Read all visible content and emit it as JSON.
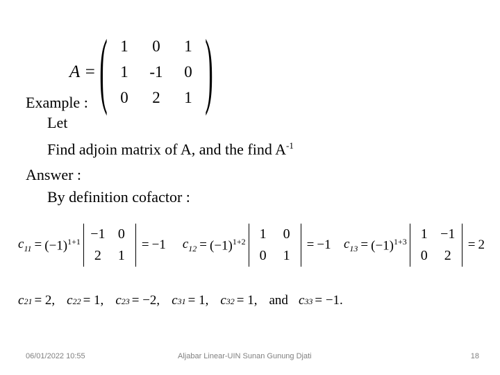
{
  "slide": {
    "background": "#ffffff",
    "text_color": "#000000",
    "footer_color": "#808080"
  },
  "matrix_a": {
    "label": "A =",
    "open_paren": "(",
    "close_paren": ")",
    "rows": [
      [
        "1",
        "0",
        "1"
      ],
      [
        "1",
        "-1",
        "0"
      ],
      [
        "0",
        "2",
        "1"
      ]
    ]
  },
  "body": {
    "example_label": "Example :",
    "let_label": "Let",
    "find_text": "Find  adjoin matrix  of A, and the find A",
    "find_sup": "-1",
    "answer_label": "Answer :",
    "by_definition": "By definition cofactor :"
  },
  "cofactors_detail": [
    {
      "name": "c",
      "sub": "11",
      "eq1": "=",
      "sign": "(−1)",
      "exponent": "1+1",
      "minor": [
        [
          "−1",
          "0"
        ],
        [
          "2",
          "1"
        ]
      ],
      "eq2": "=",
      "result": "−1"
    },
    {
      "name": "c",
      "sub": "12",
      "eq1": "=",
      "sign": "(−1)",
      "exponent": "1+2",
      "minor": [
        [
          "1",
          "0"
        ],
        [
          "0",
          "1"
        ]
      ],
      "eq2": "=",
      "result": "−1"
    },
    {
      "name": "c",
      "sub": "13",
      "eq1": "=",
      "sign": "(−1)",
      "exponent": "1+3",
      "minor": [
        [
          "1",
          "−1"
        ],
        [
          "0",
          "2"
        ]
      ],
      "eq2": "=",
      "result": "2"
    }
  ],
  "cofactor_values": [
    {
      "name": "c",
      "sub": "21",
      "value": "= 2,"
    },
    {
      "name": "c",
      "sub": "22",
      "value": "= 1,"
    },
    {
      "name": "c",
      "sub": "23",
      "value": "= −2,"
    },
    {
      "name": "c",
      "sub": "31",
      "value": "= 1,"
    },
    {
      "name": "c",
      "sub": "32",
      "value": "= 1,"
    }
  ],
  "cofactor_conjunction": "and",
  "cofactor_last": {
    "name": "c",
    "sub": "33",
    "value": "= −1."
  },
  "footer": {
    "date": "06/01/2022 10:55",
    "title": "Aljabar Linear-UIN Sunan Gunung Djati",
    "page": "18"
  }
}
